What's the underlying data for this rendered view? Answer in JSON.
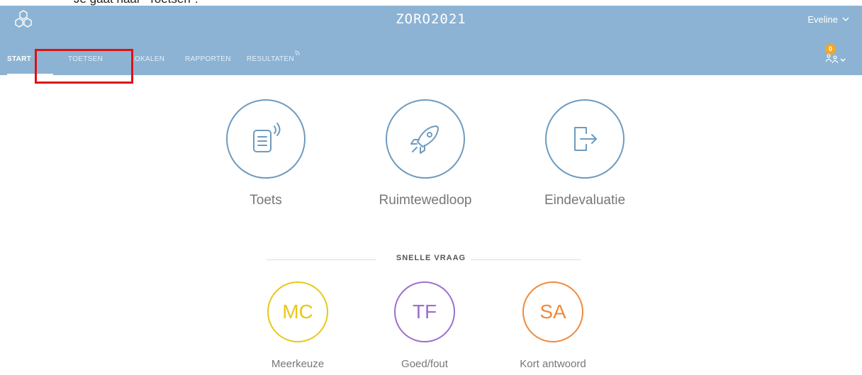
{
  "caption": {
    "text": "Je gaat naar \"Toetsen\"."
  },
  "header": {
    "app_title": "ZORO2021",
    "user_name": "Eveline",
    "notification_count": "0"
  },
  "nav": {
    "items": [
      {
        "label": "START",
        "active": true
      },
      {
        "label": "TOETSEN"
      },
      {
        "label": "LOKALEN"
      },
      {
        "label": "RAPPORTEN"
      },
      {
        "label": "RESULTATEN"
      }
    ]
  },
  "main": {
    "actions": [
      {
        "label": "Toets",
        "icon": "document-broadcast-icon"
      },
      {
        "label": "Ruimtewedloop",
        "icon": "rocket-icon"
      },
      {
        "label": "Eindevaluatie",
        "icon": "exit-door-icon"
      }
    ]
  },
  "quick_question": {
    "title": "SNELLE VRAAG",
    "items": [
      {
        "abbr": "MC",
        "label": "Meerkeuze",
        "color": "#e8c81a"
      },
      {
        "abbr": "TF",
        "label": "Goed/fout",
        "color": "#9b6fcf"
      },
      {
        "abbr": "SA",
        "label": "Kort antwoord",
        "color": "#f08a3c"
      }
    ]
  },
  "colors": {
    "header_bg": "#8cb3d4",
    "icon_stroke": "#6e9bbf",
    "highlight": "#e01010",
    "badge": "#f5a623"
  }
}
